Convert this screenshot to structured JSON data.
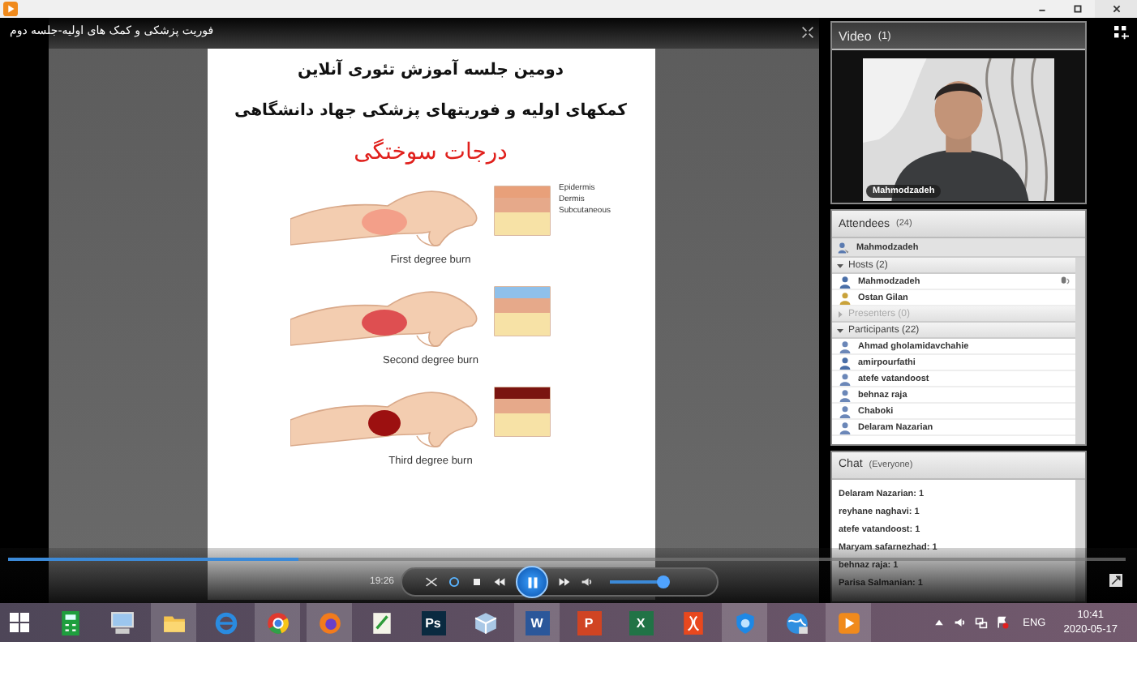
{
  "player": {
    "title": "فوریت پزشکی و کمک های اولیه-جلسه دوم",
    "time": "19:26",
    "playing": true,
    "progress": {
      "level": 0.26
    },
    "volume": {
      "level": 0.92
    }
  },
  "slide": {
    "heading": "دومین جلسه آموزش تئوری آنلاین",
    "subheading": "کمکهای اولیه و فوریتهای پزشکی جهاد دانشگاهی",
    "title": "درجات سوختگی",
    "layers": [
      "Epidermis",
      "Dermis",
      "Subcutaneous"
    ],
    "burns": [
      {
        "kind": "first",
        "label": "First degree burn"
      },
      {
        "kind": "second",
        "label": "Second degree burn"
      },
      {
        "kind": "third",
        "label": "Third degree burn"
      }
    ]
  },
  "video_pod": {
    "title": "Video",
    "count": "(1)",
    "name": "Mahmodzadeh"
  },
  "attendees": {
    "title": "Attendees",
    "count": "(24)",
    "me": "Mahmodzadeh",
    "groups": [
      {
        "label": "Hosts (2)",
        "expanded": true,
        "disabled": false,
        "members": [
          {
            "name": "Mahmodzadeh",
            "kind": "host",
            "speaking": true
          },
          {
            "name": "Ostan Gilan",
            "kind": "owner",
            "speaking": false
          }
        ]
      },
      {
        "label": "Presenters (0)",
        "expanded": false,
        "disabled": true
      },
      {
        "label": "Participants (22)",
        "expanded": true,
        "disabled": false,
        "members": [
          {
            "name": "Ahmad gholamidavchahie",
            "kind": "participant",
            "speaking": false
          },
          {
            "name": "amirpourfathi",
            "kind": "host",
            "speaking": false
          },
          {
            "name": "atefe vatandoost",
            "kind": "participant",
            "speaking": false
          },
          {
            "name": "behnaz raja",
            "kind": "participant",
            "speaking": false
          },
          {
            "name": "Chaboki",
            "kind": "participant",
            "speaking": false
          },
          {
            "name": "Delaram Nazarian",
            "kind": "participant",
            "speaking": false
          }
        ]
      }
    ]
  },
  "chat": {
    "title": "Chat",
    "scope": "(Everyone)",
    "messages": [
      "Delaram Nazarian: 1",
      "reyhane naghavi: 1",
      "atefe vatandoost: 1",
      "Maryam safarnezhad: 1",
      "behnaz raja: 1",
      "Parisa Salmanian: 1"
    ]
  },
  "taskbar": {
    "apps": [
      {
        "kind": "calculator",
        "active": false
      },
      {
        "kind": "computer",
        "active": false
      },
      {
        "kind": "folder",
        "active": true
      },
      {
        "kind": "browser-e",
        "active": false
      },
      {
        "kind": "chrome",
        "active": true
      },
      {
        "kind": "firefox",
        "active": true
      },
      {
        "kind": "notepad",
        "active": false
      },
      {
        "kind": "glyph",
        "glyph": "Ps",
        "color": "#0a2a40",
        "active": false
      },
      {
        "kind": "cube",
        "active": false
      },
      {
        "kind": "glyph",
        "glyph": "W",
        "color": "#2b579a",
        "active": true
      },
      {
        "kind": "glyph",
        "glyph": "P",
        "color": "#d04423",
        "active": false
      },
      {
        "kind": "glyph",
        "glyph": "X",
        "color": "#217346",
        "active": false
      },
      {
        "kind": "pdf",
        "active": false
      },
      {
        "kind": "shield",
        "active": true
      },
      {
        "kind": "globe",
        "active": false
      },
      {
        "kind": "player",
        "active": true
      }
    ],
    "language": "ENG",
    "time": "10:41",
    "date": "2020-05-17"
  }
}
